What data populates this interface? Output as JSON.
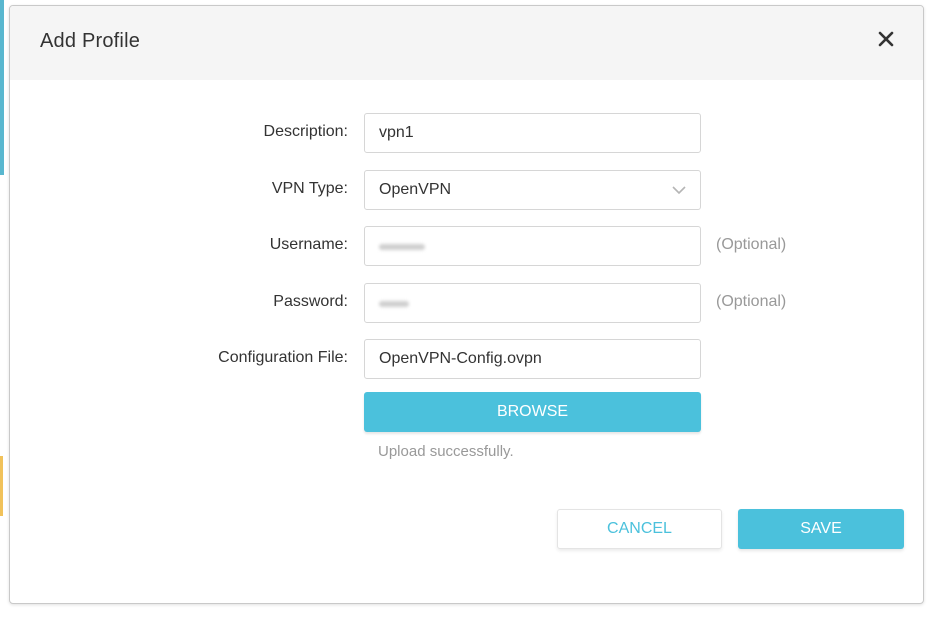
{
  "dialog": {
    "title": "Add Profile",
    "close_icon": "close-icon"
  },
  "form": {
    "description": {
      "label": "Description:",
      "value": "vpn1"
    },
    "vpn_type": {
      "label": "VPN Type:",
      "selected": "OpenVPN",
      "icon": "chevron-down-icon"
    },
    "username": {
      "label": "Username:",
      "value_obscured": true,
      "hint": "(Optional)"
    },
    "password": {
      "label": "Password:",
      "value_obscured": true,
      "hint": "(Optional)"
    },
    "config_file": {
      "label": "Configuration File:",
      "value": "OpenVPN-Config.ovpn"
    },
    "browse_label": "BROWSE",
    "upload_status": "Upload successfully."
  },
  "actions": {
    "cancel_label": "CANCEL",
    "save_label": "SAVE"
  },
  "colors": {
    "accent": "#4bc1dc",
    "header_bg": "#f5f5f5",
    "hint_text": "#999999"
  }
}
